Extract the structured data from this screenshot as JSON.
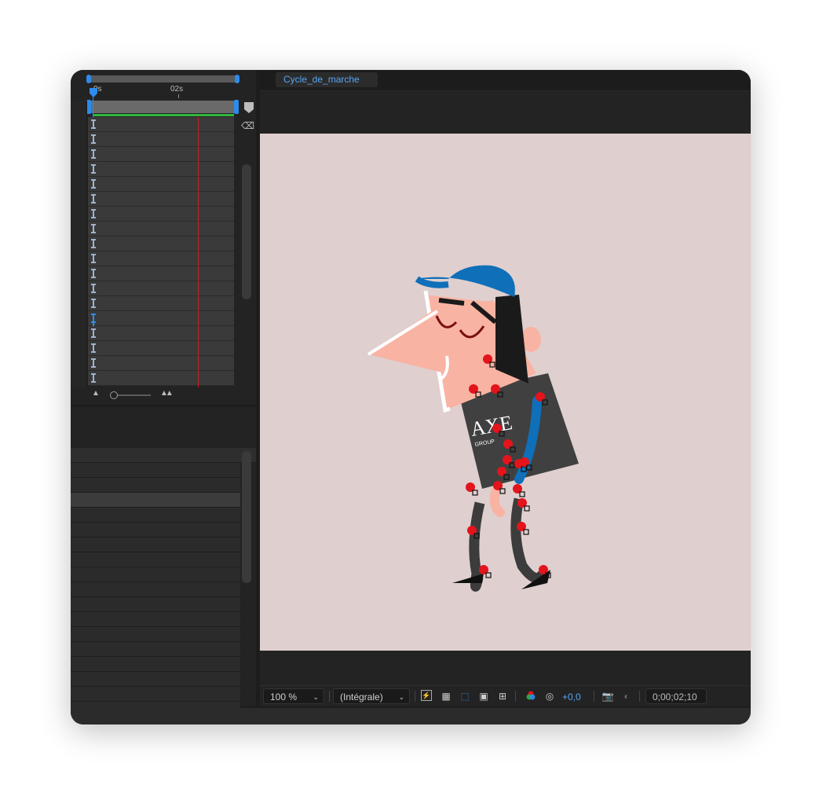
{
  "timeline": {
    "ruler_start": "0s",
    "ruler_mid": "02s",
    "row_count": 18,
    "selected_row": 13
  },
  "viewer": {
    "tab_label": "Cycle_de_marche",
    "canvas_color": "#dfcfcf"
  },
  "toolbar": {
    "zoom": "100 %",
    "resolution": "(Intégrale)",
    "exposure": "+0,0",
    "timecode": "0;00;02;10"
  },
  "colors": {
    "accent": "#2d8ceb",
    "work_area_bar": "#2fb63c",
    "current_time_line": "#c8202a",
    "cap": "#0f6fb9",
    "skin": "#f9b3a3",
    "shirt": "#404040",
    "rig_handles": "#e3141c"
  },
  "icons": [
    "fast-preview-icon",
    "transparency-grid-icon",
    "mask-path-icon",
    "region-of-interest-icon",
    "guides-icon",
    "color-channels-icon",
    "reset-exposure-icon",
    "snapshot-icon",
    "show-snapshot-icon"
  ]
}
